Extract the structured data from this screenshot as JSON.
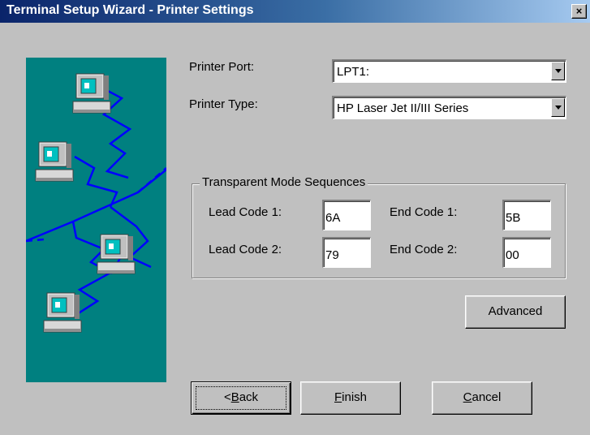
{
  "window": {
    "title": "Terminal Setup Wizard - Printer Settings",
    "close_glyph": "×"
  },
  "illustration": {
    "description_icon": "networked-computers",
    "background": "#008080",
    "line_color": "#0000ff"
  },
  "printer_port": {
    "label": "Printer Port:",
    "value": "LPT1:"
  },
  "printer_type": {
    "label": "Printer Type:",
    "value": "HP Laser Jet II/III Series"
  },
  "sequences": {
    "title": "Transparent Mode Sequences",
    "lead1_label": "Lead Code 1:",
    "lead1_value": "6A",
    "end1_label": "End Code 1:",
    "end1_value": "5B",
    "lead2_label": "Lead Code 2:",
    "lead2_value": "79",
    "end2_label": "End Code 2:",
    "end2_value": "00"
  },
  "buttons": {
    "advanced": "Advanced",
    "back_prefix": "<",
    "back_key": "B",
    "back_rest": "ack",
    "finish_key": "F",
    "finish_rest": "inish",
    "cancel_key": "C",
    "cancel_rest": "ancel"
  }
}
